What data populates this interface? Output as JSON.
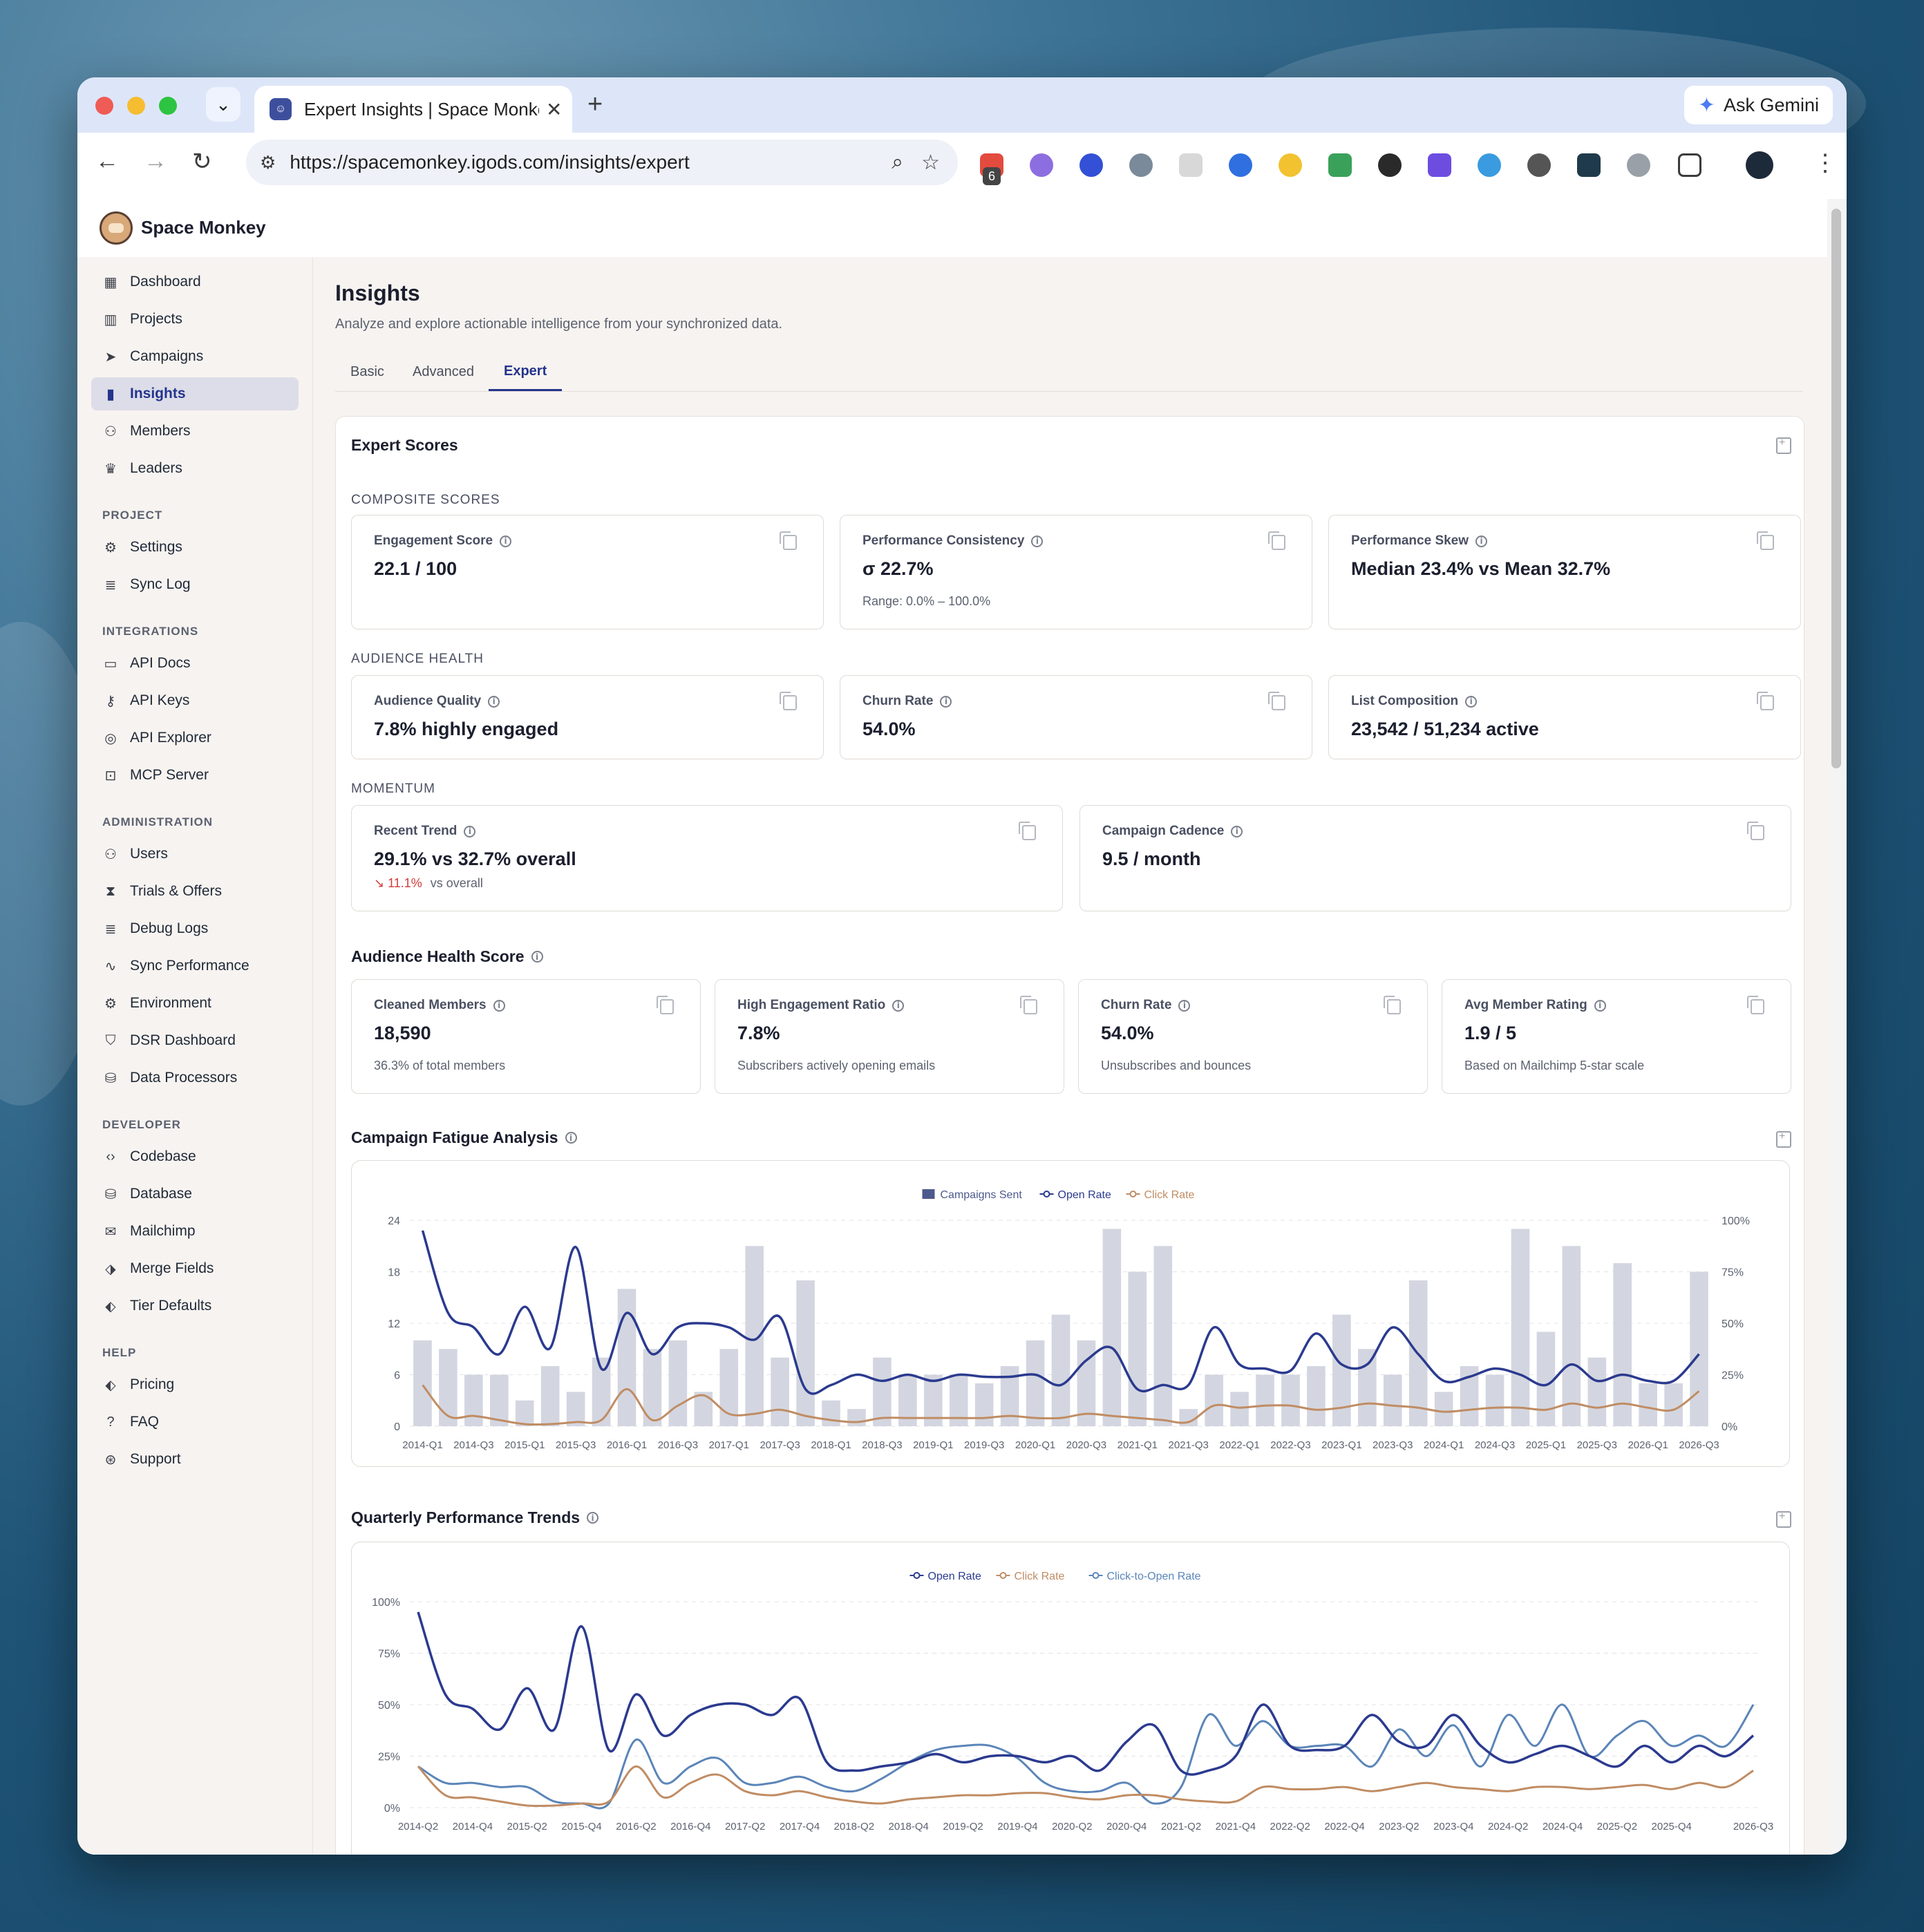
{
  "browser": {
    "tab_title": "Expert Insights | Space Monkey",
    "url": "https://spacemonkey.igods.com/insights/expert",
    "ask_gemini": "Ask Gemini",
    "ext_badge": "6"
  },
  "app": {
    "brand": "Space Monkey"
  },
  "sidebar": {
    "main": [
      {
        "label": "Dashboard",
        "icon": "grid-icon"
      },
      {
        "label": "Projects",
        "icon": "building-icon"
      },
      {
        "label": "Campaigns",
        "icon": "send-icon"
      },
      {
        "label": "Insights",
        "icon": "bar-chart-icon",
        "active": true
      },
      {
        "label": "Members",
        "icon": "users-icon"
      },
      {
        "label": "Leaders",
        "icon": "crown-icon"
      }
    ],
    "sections": [
      {
        "label": "PROJECT",
        "items": [
          {
            "label": "Settings",
            "icon": "gear-icon"
          },
          {
            "label": "Sync Log",
            "icon": "log-icon"
          }
        ]
      },
      {
        "label": "INTEGRATIONS",
        "items": [
          {
            "label": "API Docs",
            "icon": "book-icon"
          },
          {
            "label": "API Keys",
            "icon": "key-icon"
          },
          {
            "label": "API Explorer",
            "icon": "globe-icon"
          },
          {
            "label": "MCP Server",
            "icon": "robot-icon"
          }
        ]
      },
      {
        "label": "ADMINISTRATION",
        "items": [
          {
            "label": "Users",
            "icon": "users-icon"
          },
          {
            "label": "Trials & Offers",
            "icon": "hourglass-icon"
          },
          {
            "label": "Debug Logs",
            "icon": "log-icon"
          },
          {
            "label": "Sync Performance",
            "icon": "activity-icon"
          },
          {
            "label": "Environment",
            "icon": "gear-icon"
          },
          {
            "label": "DSR Dashboard",
            "icon": "shield-icon"
          },
          {
            "label": "Data Processors",
            "icon": "database-icon"
          }
        ]
      },
      {
        "label": "DEVELOPER",
        "items": [
          {
            "label": "Codebase",
            "icon": "code-icon"
          },
          {
            "label": "Database",
            "icon": "database-icon"
          },
          {
            "label": "Mailchimp",
            "icon": "mail-icon"
          },
          {
            "label": "Merge Fields",
            "icon": "tags-icon"
          },
          {
            "label": "Tier Defaults",
            "icon": "tag-icon"
          }
        ]
      },
      {
        "label": "HELP",
        "items": [
          {
            "label": "Pricing",
            "icon": "tag-icon"
          },
          {
            "label": "FAQ",
            "icon": "help-icon"
          },
          {
            "label": "Support",
            "icon": "lifebuoy-icon"
          }
        ]
      }
    ]
  },
  "page": {
    "title": "Insights",
    "subtitle": "Analyze and explore actionable intelligence from your synchronized data.",
    "tabs": [
      "Basic",
      "Advanced",
      "Expert"
    ],
    "active_tab": "Expert"
  },
  "expert": {
    "title": "Expert Scores",
    "composite_label": "COMPOSITE SCORES",
    "composite": [
      {
        "label": "Engagement Score",
        "value": "22.1 / 100",
        "note": ""
      },
      {
        "label": "Performance Consistency",
        "value": "σ 22.7%",
        "note": "Range: 0.0% – 100.0%"
      },
      {
        "label": "Performance Skew",
        "value": "Median 23.4% vs Mean 32.7%",
        "note": ""
      }
    ],
    "audience_label": "AUDIENCE HEALTH",
    "audience": [
      {
        "label": "Audience Quality",
        "value": "7.8% highly engaged"
      },
      {
        "label": "Churn Rate",
        "value": "54.0%"
      },
      {
        "label": "List Composition",
        "value": "23,542 / 51,234 active"
      }
    ],
    "momentum_label": "MOMENTUM",
    "momentum": [
      {
        "label": "Recent Trend",
        "value": "29.1% vs 32.7% overall",
        "trend": "11.1%",
        "trend_suffix": "vs overall"
      },
      {
        "label": "Campaign Cadence",
        "value": "9.5 / month"
      }
    ]
  },
  "health": {
    "title": "Audience Health Score",
    "cards": [
      {
        "label": "Cleaned Members",
        "value": "18,590",
        "note": "36.3% of total members"
      },
      {
        "label": "High Engagement Ratio",
        "value": "7.8%",
        "note": "Subscribers actively opening emails"
      },
      {
        "label": "Churn Rate",
        "value": "54.0%",
        "note": "Unsubscribes and bounces"
      },
      {
        "label": "Avg Member Rating",
        "value": "1.9 / 5",
        "note": "Based on Mailchimp 5-star scale"
      }
    ]
  },
  "fatigue_title": "Campaign Fatigue Analysis",
  "quarterly_title": "Quarterly Performance Trends",
  "colors": {
    "accent": "#24348c",
    "open": "#2b3a8f",
    "click": "#c08c63",
    "cto": "#5b85b8",
    "bar": "#d3d6e0"
  },
  "chart_data": [
    {
      "type": "bar",
      "legend": [
        "Campaigns Sent",
        "Open Rate",
        "Click Rate"
      ],
      "x": [
        "2014-Q1",
        "2014-Q2",
        "2014-Q3",
        "2014-Q4",
        "2015-Q1",
        "2015-Q2",
        "2015-Q3",
        "2015-Q4",
        "2016-Q1",
        "2016-Q2",
        "2016-Q3",
        "2016-Q4",
        "2017-Q1",
        "2017-Q2",
        "2017-Q3",
        "2017-Q4",
        "2018-Q1",
        "2018-Q2",
        "2018-Q3",
        "2018-Q4",
        "2019-Q1",
        "2019-Q2",
        "2019-Q3",
        "2019-Q4",
        "2020-Q1",
        "2020-Q2",
        "2020-Q3",
        "2020-Q4",
        "2021-Q1",
        "2021-Q2",
        "2021-Q3",
        "2021-Q4",
        "2022-Q1",
        "2022-Q2",
        "2022-Q3",
        "2022-Q4",
        "2023-Q1",
        "2023-Q2",
        "2023-Q3",
        "2023-Q4",
        "2024-Q1",
        "2024-Q2",
        "2024-Q3",
        "2024-Q4",
        "2025-Q1",
        "2025-Q2",
        "2025-Q3",
        "2025-Q4",
        "2026-Q1",
        "2026-Q2",
        "2026-Q3"
      ],
      "tick_labels": [
        "2014-Q1",
        "2014-Q3",
        "2015-Q1",
        "2015-Q3",
        "2016-Q1",
        "2016-Q3",
        "2017-Q1",
        "2017-Q3",
        "2018-Q1",
        "2018-Q3",
        "2019-Q1",
        "2019-Q3",
        "2020-Q1",
        "2020-Q3",
        "2021-Q1",
        "2021-Q3",
        "2022-Q1",
        "2022-Q3",
        "2023-Q1",
        "2023-Q3",
        "2024-Q1",
        "2024-Q3",
        "2025-Q1",
        "2025-Q3",
        "2026-Q1",
        "2026-Q3"
      ],
      "series": [
        {
          "name": "Campaigns Sent",
          "axis": "left",
          "values": [
            10,
            9,
            6,
            6,
            3,
            7,
            4,
            8,
            16,
            9,
            10,
            4,
            9,
            21,
            8,
            17,
            3,
            2,
            8,
            6,
            6,
            6,
            5,
            7,
            10,
            13,
            10,
            23,
            18,
            21,
            2,
            6,
            4,
            6,
            6,
            7,
            13,
            9,
            6,
            17,
            4,
            7,
            6,
            23,
            11,
            21,
            8,
            19,
            5,
            5,
            18
          ]
        },
        {
          "name": "Open Rate",
          "axis": "right",
          "values": [
            95,
            55,
            48,
            35,
            58,
            38,
            87,
            28,
            55,
            35,
            48,
            50,
            48,
            42,
            53,
            18,
            20,
            25,
            22,
            25,
            22,
            25,
            24,
            24,
            25,
            20,
            32,
            38,
            18,
            20,
            20,
            48,
            30,
            28,
            27,
            45,
            30,
            30,
            48,
            35,
            22,
            24,
            28,
            25,
            20,
            30,
            22,
            25,
            22,
            22,
            35
          ]
        },
        {
          "name": "Click Rate",
          "axis": "right",
          "values": [
            20,
            5,
            5,
            3,
            1,
            1,
            2,
            3,
            18,
            3,
            10,
            15,
            6,
            6,
            8,
            5,
            3,
            2,
            4,
            4,
            4,
            4,
            4,
            5,
            4,
            4,
            6,
            5,
            4,
            3,
            2,
            10,
            9,
            10,
            10,
            8,
            9,
            11,
            10,
            9,
            7,
            8,
            9,
            9,
            8,
            11,
            9,
            11,
            9,
            8,
            17
          ]
        }
      ],
      "ylim_left": [
        0,
        24
      ],
      "yticks_left": [
        "0",
        "6",
        "12",
        "18",
        "24"
      ],
      "ylim_right": [
        0,
        100
      ],
      "yticks_right": [
        "0%",
        "25%",
        "50%",
        "75%",
        "100%"
      ],
      "grid": true,
      "legend_position": "top"
    },
    {
      "type": "line",
      "legend": [
        "Open Rate",
        "Click Rate",
        "Click-to-Open Rate"
      ],
      "x": [
        "2014-Q2",
        "2014-Q3",
        "2014-Q4",
        "2015-Q1",
        "2015-Q2",
        "2015-Q3",
        "2015-Q4",
        "2016-Q1",
        "2016-Q2",
        "2016-Q3",
        "2016-Q4",
        "2017-Q1",
        "2017-Q2",
        "2017-Q3",
        "2017-Q4",
        "2018-Q1",
        "2018-Q2",
        "2018-Q3",
        "2018-Q4",
        "2019-Q1",
        "2019-Q2",
        "2019-Q3",
        "2019-Q4",
        "2020-Q1",
        "2020-Q2",
        "2020-Q3",
        "2020-Q4",
        "2021-Q1",
        "2021-Q2",
        "2021-Q3",
        "2021-Q4",
        "2022-Q1",
        "2022-Q2",
        "2022-Q3",
        "2022-Q4",
        "2023-Q1",
        "2023-Q2",
        "2023-Q3",
        "2023-Q4",
        "2024-Q1",
        "2024-Q2",
        "2024-Q3",
        "2024-Q4",
        "2025-Q1",
        "2025-Q2",
        "2025-Q3",
        "2025-Q4",
        "2026-Q1",
        "2026-Q2",
        "2026-Q3"
      ],
      "tick_labels": [
        "2014-Q2",
        "2014-Q4",
        "2015-Q2",
        "2015-Q4",
        "2016-Q2",
        "2016-Q4",
        "2017-Q2",
        "2017-Q4",
        "2018-Q2",
        "2018-Q4",
        "2019-Q2",
        "2019-Q4",
        "2020-Q2",
        "2020-Q4",
        "2021-Q2",
        "2021-Q4",
        "2022-Q2",
        "2022-Q4",
        "2023-Q2",
        "2023-Q4",
        "2024-Q2",
        "2024-Q4",
        "2025-Q2",
        "2025-Q4",
        "2026-Q3"
      ],
      "series": [
        {
          "name": "Open Rate",
          "values": [
            95,
            55,
            48,
            38,
            58,
            38,
            88,
            28,
            55,
            35,
            45,
            50,
            50,
            45,
            53,
            22,
            18,
            20,
            22,
            26,
            22,
            25,
            25,
            22,
            25,
            18,
            32,
            40,
            18,
            18,
            25,
            50,
            30,
            28,
            30,
            45,
            32,
            30,
            45,
            30,
            22,
            26,
            30,
            25,
            20,
            30,
            22,
            30,
            25,
            35
          ]
        },
        {
          "name": "Click Rate",
          "values": [
            20,
            6,
            5,
            3,
            1,
            1,
            2,
            3,
            20,
            5,
            12,
            16,
            8,
            6,
            8,
            5,
            3,
            2,
            4,
            5,
            6,
            6,
            7,
            7,
            5,
            4,
            6,
            6,
            4,
            3,
            3,
            10,
            9,
            9,
            10,
            8,
            10,
            12,
            10,
            9,
            8,
            10,
            10,
            9,
            10,
            11,
            9,
            12,
            10,
            18
          ]
        },
        {
          "name": "Click-to-Open Rate",
          "values": [
            20,
            12,
            12,
            10,
            10,
            3,
            2,
            2,
            33,
            12,
            20,
            24,
            12,
            12,
            15,
            10,
            8,
            14,
            22,
            28,
            30,
            30,
            24,
            12,
            8,
            8,
            12,
            2,
            10,
            45,
            30,
            42,
            30,
            30,
            30,
            20,
            38,
            25,
            40,
            20,
            45,
            30,
            50,
            25,
            35,
            42,
            30,
            35,
            30,
            50
          ]
        }
      ],
      "ylim": [
        0,
        100
      ],
      "yticks": [
        "0%",
        "25%",
        "50%",
        "75%",
        "100%"
      ],
      "grid": true,
      "legend_position": "top"
    }
  ]
}
